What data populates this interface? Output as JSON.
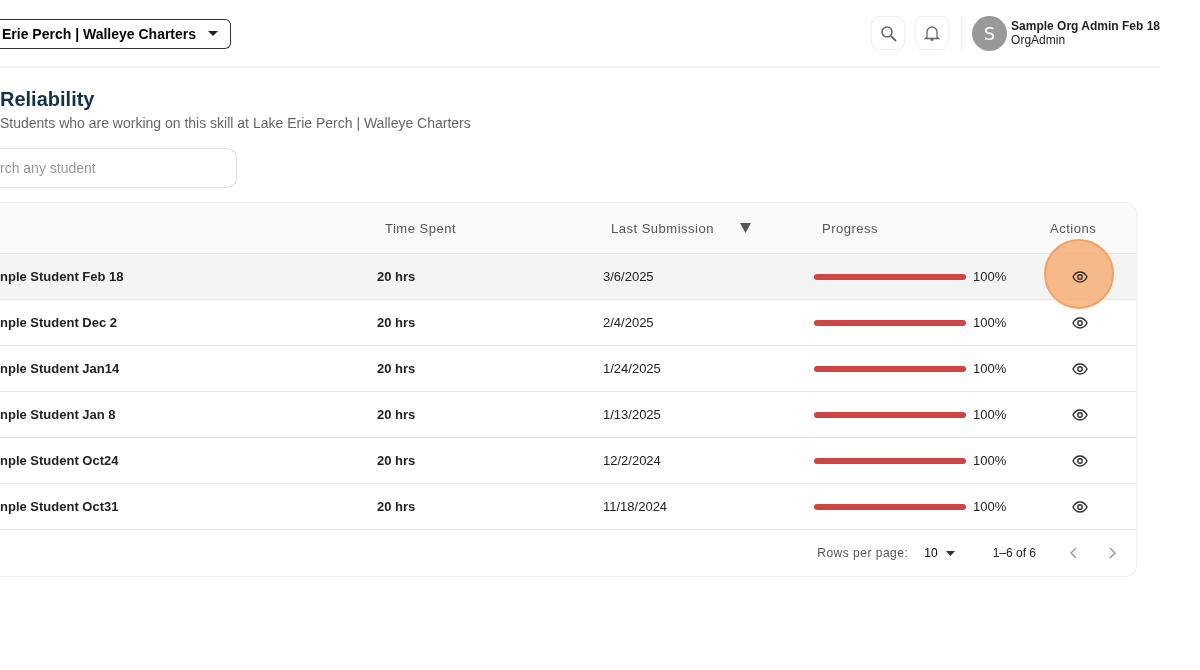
{
  "header": {
    "org_select": "Erie Perch | Walleye Charters",
    "user": {
      "initial": "S",
      "name": "Sample Org Admin Feb 18",
      "role": "OrgAdmin"
    }
  },
  "page": {
    "title": "Reliability",
    "subtitle": "Students who are working on this skill at Lake Erie Perch | Walleye Charters"
  },
  "search": {
    "placeholder": "rch any student"
  },
  "table": {
    "columns": [
      {
        "label": "Time Spent",
        "sorted": false
      },
      {
        "label": "Last Submission",
        "sorted": true
      },
      {
        "label": "Progress",
        "sorted": false
      },
      {
        "label": "Actions",
        "sorted": false
      }
    ],
    "rows": [
      {
        "name": "nple Student Feb 18",
        "time": "20 hrs",
        "last": "3/6/2025",
        "level": 1,
        "percent": "100%",
        "selected": true
      },
      {
        "name": "nple Student Dec 2",
        "time": "20 hrs",
        "last": "2/4/2025",
        "level": 1,
        "percent": "100%",
        "selected": false
      },
      {
        "name": "nple Student Jan14",
        "time": "20 hrs",
        "last": "1/24/2025",
        "level": 1,
        "percent": "100%",
        "selected": false
      },
      {
        "name": "nple Student Jan 8",
        "time": "20 hrs",
        "last": "1/13/2025",
        "level": 1,
        "percent": "100%",
        "selected": false
      },
      {
        "name": "nple Student Oct24",
        "time": "20 hrs",
        "last": "12/2/2024",
        "level": 1,
        "percent": "100%",
        "selected": false
      },
      {
        "name": "nple Student Oct31",
        "time": "20 hrs",
        "last": "11/18/2024",
        "level": 1,
        "percent": "100%",
        "selected": false
      }
    ]
  },
  "pagination": {
    "rows_label": "Rows per page:",
    "rows_value": "10",
    "range": "1–6 of 6"
  }
}
